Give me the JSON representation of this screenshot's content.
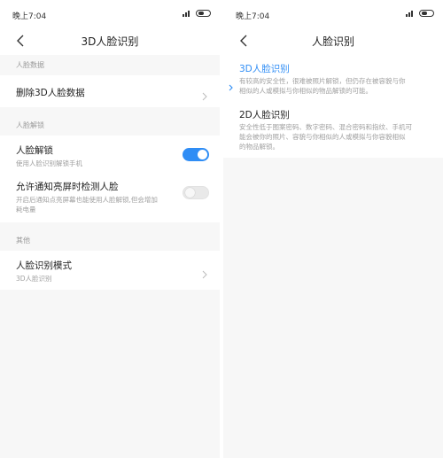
{
  "colors": {
    "accent": "#2f8df5",
    "background": "#f7f7f7",
    "card": "#ffffff",
    "secondary_text": "#a0a0a0"
  },
  "left": {
    "status_time": "晚上7:04",
    "title": "3D人脸识别",
    "sections": [
      {
        "label": "人脸数据"
      },
      {
        "label": "人脸解锁"
      },
      {
        "label": "其他"
      }
    ],
    "rows": {
      "delete_face": {
        "label": "删除3D人脸数据"
      },
      "face_unlock": {
        "label": "人脸解锁",
        "sub": "使用人脸识别解锁手机",
        "toggle": "on"
      },
      "notify_wake": {
        "label": "允许通知亮屏时检测人脸",
        "sub_line1": "开启后通知点亮屏幕也能使用人脸解锁,但会增加",
        "sub_line2": "耗电量",
        "toggle": "off"
      },
      "recognition_mode": {
        "label": "人脸识别模式",
        "sub": "3D人脸识别"
      }
    }
  },
  "right": {
    "status_time": "晚上7:04",
    "title": "人脸识别",
    "options": [
      {
        "label": "3D人脸识别",
        "desc_line1": "有较高的安全性，很难被照片解锁，但仍存在被容貌与你",
        "desc_line2": "相似的人或模拟与你相似的物品解锁的可能。",
        "selected": true
      },
      {
        "label": "2D人脸识别",
        "desc_line1": "安全性低于图案密码、数字密码、混合密码和指纹、手机可",
        "desc_line2": "能会被你的照片、容貌与你相似的人或模拟与你容貌相似",
        "desc_line3": "的物品解锁。",
        "selected": false
      }
    ]
  }
}
